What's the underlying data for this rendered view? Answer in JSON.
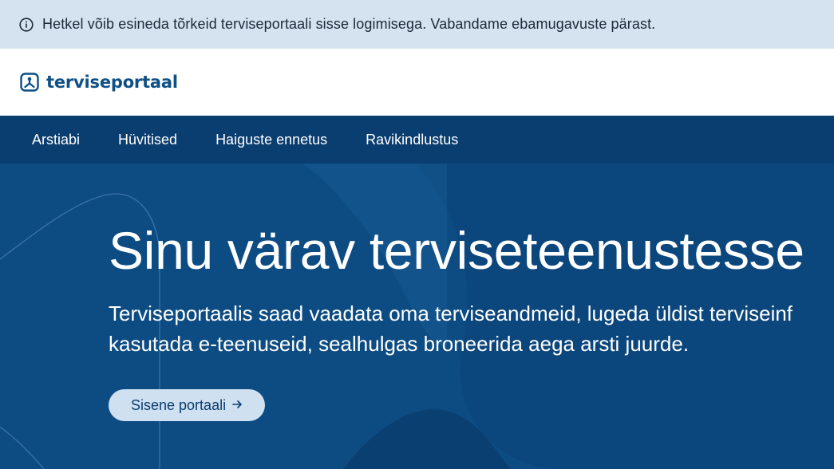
{
  "notice": {
    "icon": "info-circle-icon",
    "text": "Hetkel võib esineda tõrkeid terviseportaali sisse logimisega. Vabandame ebamugavuste pärast."
  },
  "header": {
    "logo_text": "terviseportaal",
    "logo_icon": "terviseportaal-logo-icon"
  },
  "nav": {
    "items": [
      {
        "label": "Arstiabi"
      },
      {
        "label": "Hüvitised"
      },
      {
        "label": "Haiguste ennetus"
      },
      {
        "label": "Ravikindlustus"
      }
    ]
  },
  "hero": {
    "title": "Sinu värav terviseteenustesse",
    "text_line1": "Terviseportaalis saad vaadata oma terviseandmeid, lugeda üldist terviseinf",
    "text_line2": "kasutada e-teenuseid, sealhulgas broneerida aega arsti juurde.",
    "cta_label": "Sisene portaali",
    "cta_icon": "arrow-right-icon"
  },
  "colors": {
    "notice_bg": "#d5e3f0",
    "nav_bg": "#0a3d70",
    "hero_bg": "#0d4c83",
    "brand": "#0e4f86",
    "cta_bg": "#cfe0f0"
  }
}
